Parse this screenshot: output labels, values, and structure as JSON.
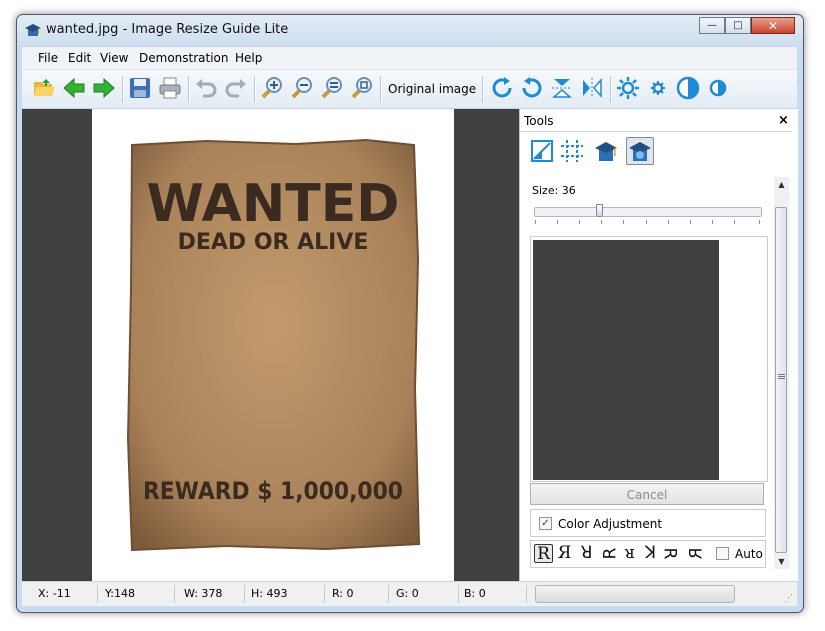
{
  "window": {
    "title": "wanted.jpg - Image Resize Guide Lite",
    "minimize_glyph": "—",
    "maximize_glyph": "□",
    "close_glyph": "✕"
  },
  "menu": [
    "File",
    "Edit",
    "View",
    "Demonstration",
    "Help"
  ],
  "toolbar": {
    "original_image_label": "Original image",
    "icons": [
      "open-folder-icon",
      "back-arrow-icon",
      "forward-arrow-icon",
      "save-icon",
      "print-icon",
      "undo-icon",
      "redo-icon",
      "zoom-in-icon",
      "zoom-out-icon",
      "zoom-fit-icon",
      "zoom-actual-icon",
      "rotate-right-icon",
      "rotate-left-icon",
      "flip-vertical-icon",
      "flip-horizontal-icon",
      "brightness-up-icon",
      "brightness-down-icon",
      "contrast-up-icon",
      "contrast-down-icon"
    ]
  },
  "poster": {
    "headline": "WANTED",
    "subline": "DEAD OR ALIVE",
    "reward": "REWARD $ 1,000,000"
  },
  "tools": {
    "title": "Tools",
    "close_glyph": "×",
    "size_label": "Size: 36",
    "size_value": 36,
    "slider_position_fraction": 0.29,
    "cancel_label": "Cancel",
    "color_adjustment_label": "Color Adjustment",
    "color_adjustment_checked": true,
    "auto_label": "Auto",
    "auto_checked": false,
    "glyphs": [
      "R",
      "Я",
      "ꓤ",
      "ꓤ",
      "ᴚ",
      "ꓘ",
      "ꓤ",
      "ꓤ"
    ]
  },
  "status": {
    "x": "X: -11",
    "y": "Y:148",
    "w": "W: 378",
    "h": "H: 493",
    "r": "R: 0",
    "g": "G: 0",
    "b": "B: 0"
  },
  "colors": {
    "canvas_bg": "#404040",
    "accent": "#1f8ad6",
    "green_arrow": "#33b233",
    "poster_paper": "#b48a5e",
    "poster_ink": "#3a2a20"
  }
}
